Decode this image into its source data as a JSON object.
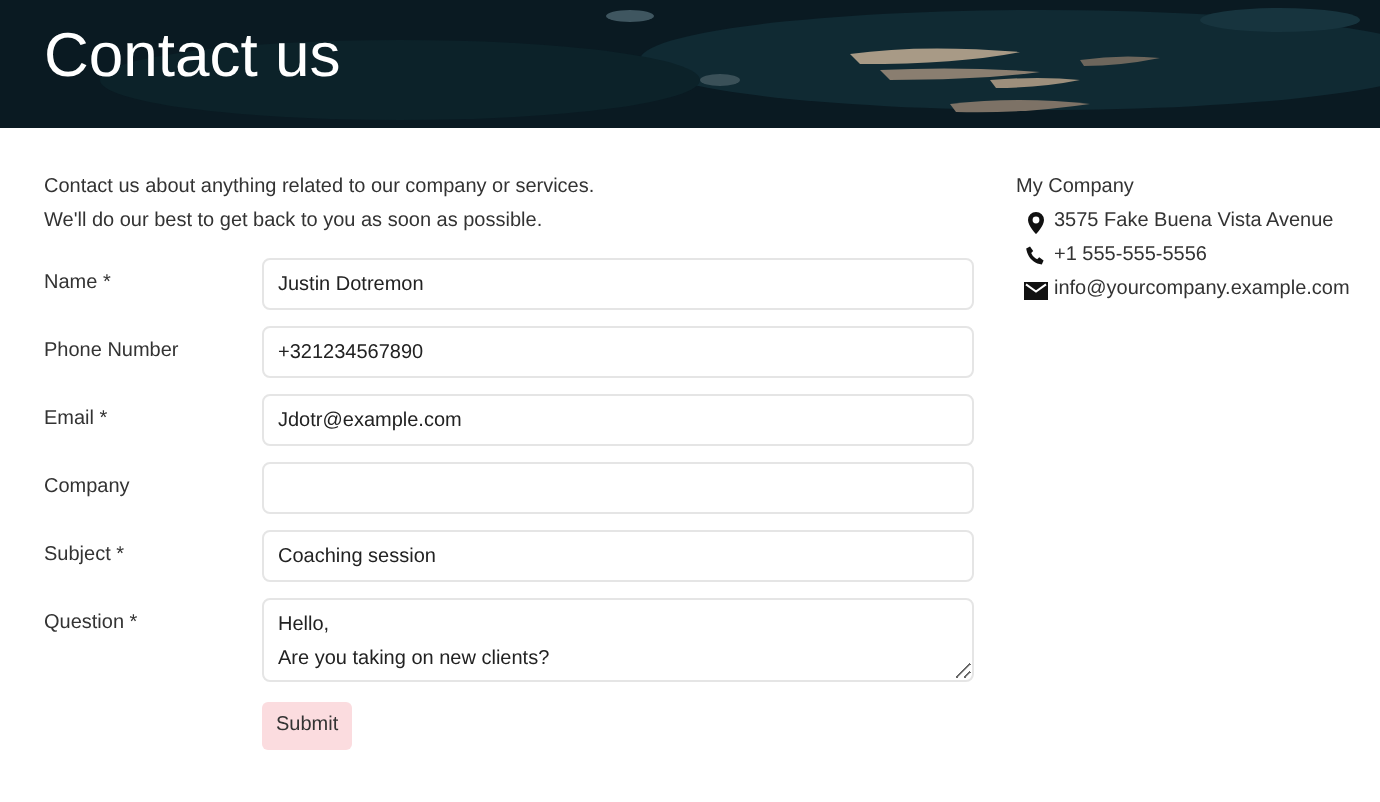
{
  "header": {
    "title": "Contact us"
  },
  "intro": [
    "Contact us about anything related to our company or services.",
    "We'll do our best to get back to you as soon as possible."
  ],
  "form": {
    "fields": [
      {
        "label": "Name *",
        "kind": "input",
        "value": "Justin Dotremon"
      },
      {
        "label": "Phone Number",
        "kind": "input",
        "value": "+321234567890"
      },
      {
        "label": "Email *",
        "kind": "input",
        "value": "Jdotr@example.com"
      },
      {
        "label": "Company",
        "kind": "input"
      },
      {
        "label": "Subject *",
        "kind": "input",
        "value": "Coaching session"
      },
      {
        "label": "Question *",
        "kind": "textarea",
        "value": "Hello,\nAre you taking on new clients?"
      }
    ],
    "submit": "Submit"
  },
  "company": {
    "name": "My Company",
    "details": [
      {
        "kind": "address",
        "text": "3575 Fake Buena Vista Avenue"
      },
      {
        "kind": "phone",
        "text": "+1 555-555-5556"
      },
      {
        "kind": "email",
        "text": "info@yourcompany.example.com"
      }
    ]
  }
}
